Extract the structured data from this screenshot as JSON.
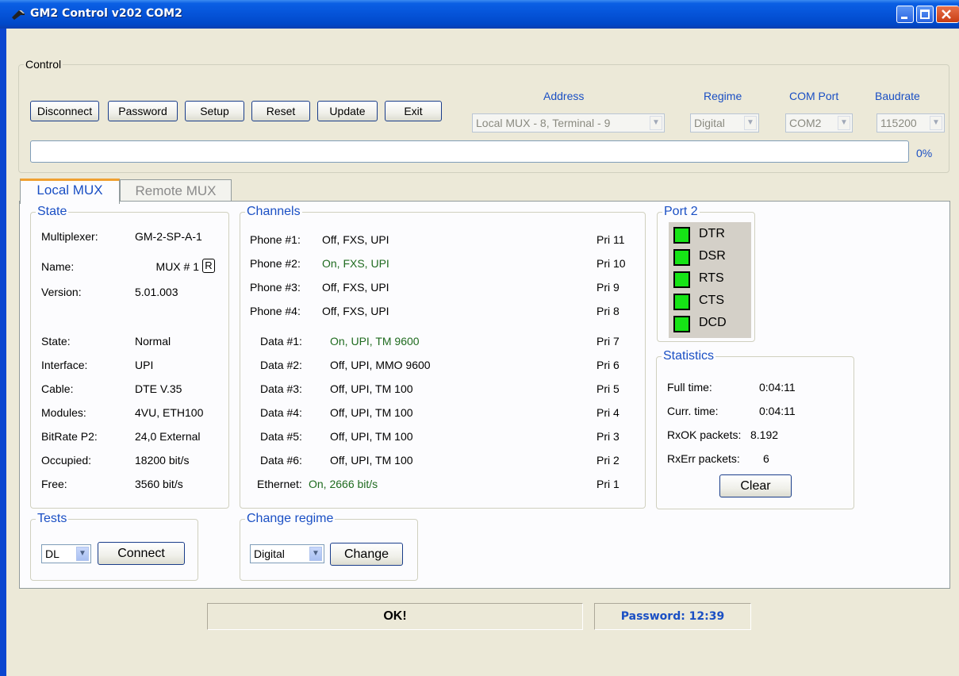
{
  "window": {
    "title": "GM2  Control v202 COM2"
  },
  "control": {
    "legend": "Control",
    "buttons": [
      "Disconnect",
      "Password",
      "Setup",
      "Reset",
      "Update",
      "Exit"
    ],
    "address_label": "Address",
    "address_value": "Local MUX - 8, Terminal - 9",
    "regime_label": "Regime",
    "regime_value": "Digital",
    "com_label": "COM Port",
    "com_value": "COM2",
    "baud_label": "Baudrate",
    "baud_value": "115200",
    "progress_text": "0%",
    "progress_value": 0
  },
  "tabs": [
    "Local MUX",
    "Remote MUX"
  ],
  "state": {
    "legend": "State",
    "rows": [
      {
        "label": "Multiplexer:",
        "value": "GM-2-SP-A-1"
      },
      {
        "label": "Name:",
        "value": "MUX # 1"
      },
      {
        "label": "Version:",
        "value": "5.01.003"
      },
      {
        "label": "State:",
        "value": "Normal"
      },
      {
        "label": "Interface:",
        "value": "UPI"
      },
      {
        "label": "Cable:",
        "value": "DTE V.35"
      },
      {
        "label": "Modules:",
        "value": "4VU, ETH100"
      },
      {
        "label": "BitRate P2:",
        "value": "24,0 External"
      },
      {
        "label": "Occupied:",
        "value": "18200 bit/s"
      },
      {
        "label": "Free:",
        "value": "3560 bit/s"
      }
    ],
    "rename_button": "R"
  },
  "channels": {
    "legend": "Channels",
    "rows": [
      {
        "label": "Phone #1:",
        "value": "Off, FXS, UPI",
        "pri": "Pri 11",
        "on": false
      },
      {
        "label": "Phone #2:",
        "value": "On, FXS, UPI",
        "pri": "Pri 10",
        "on": true
      },
      {
        "label": "Phone #3:",
        "value": "Off, FXS, UPI",
        "pri": "Pri 9",
        "on": false
      },
      {
        "label": "Phone #4:",
        "value": "Off, FXS, UPI",
        "pri": "Pri 8",
        "on": false
      },
      {
        "label": "Data #1:",
        "value": "On, UPI, TM 9600",
        "pri": "Pri 7",
        "on": true
      },
      {
        "label": "Data #2:",
        "value": "Off, UPI, MMO 9600",
        "pri": "Pri 6",
        "on": false
      },
      {
        "label": "Data #3:",
        "value": "Off, UPI, TM 100",
        "pri": "Pri 5",
        "on": false
      },
      {
        "label": "Data #4:",
        "value": "Off, UPI, TM 100",
        "pri": "Pri 4",
        "on": false
      },
      {
        "label": "Data #5:",
        "value": "Off, UPI, TM 100",
        "pri": "Pri 3",
        "on": false
      },
      {
        "label": "Data #6:",
        "value": "Off, UPI, TM 100",
        "pri": "Pri 2",
        "on": false
      },
      {
        "label": "Ethernet:",
        "value": "On, 2666 bit/s",
        "pri": "Pri 1",
        "on": true
      }
    ]
  },
  "port2": {
    "legend": "Port 2",
    "signals": [
      "DTR",
      "DSR",
      "RTS",
      "CTS",
      "DCD"
    ],
    "led_color": "#16e416"
  },
  "statistics": {
    "legend": "Statistics",
    "full_time_label": "Full time:",
    "full_time": "0:04:11",
    "curr_time_label": "Curr. time:",
    "curr_time": "0:04:11",
    "rxok_label": "RxOK packets:",
    "rxok": "8.192",
    "rxerr_label": "RxErr packets:",
    "rxerr": "6",
    "clear_button": "Clear"
  },
  "tests": {
    "legend": "Tests",
    "select_value": "DL",
    "connect_button": "Connect"
  },
  "change_regime": {
    "legend": "Change regime",
    "select_value": "Digital",
    "change_button": "Change"
  },
  "statusbar": {
    "message": "OK!",
    "password": "Password: 12:39"
  },
  "colors": {
    "title_bar": "#0553d8",
    "accent_tab": "#f0a030",
    "legend_blue": "#1a4fc4",
    "on_text": "#1f6b1f"
  }
}
